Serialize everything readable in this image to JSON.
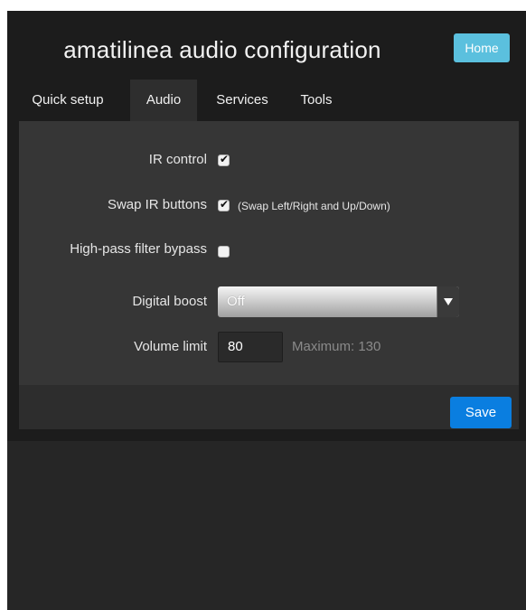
{
  "header": {
    "title": "amatilinea audio configuration",
    "home_label": "Home"
  },
  "tabs": [
    {
      "label": "Quick setup",
      "active": false
    },
    {
      "label": "Audio",
      "active": true
    },
    {
      "label": "Services",
      "active": false
    },
    {
      "label": "Tools",
      "active": false
    }
  ],
  "form": {
    "ir_control": {
      "label": "IR control",
      "checked": true
    },
    "swap_ir": {
      "label": "Swap IR buttons",
      "checked": true,
      "hint": "(Swap Left/Right and Up/Down)"
    },
    "hp_filter": {
      "label": "High-pass filter bypass",
      "checked": false
    },
    "digital_boost": {
      "label": "Digital boost",
      "value": "Off"
    },
    "volume_limit": {
      "label": "Volume limit",
      "value": "80",
      "max_text": "Maximum: 130"
    }
  },
  "footer": {
    "save_label": "Save"
  },
  "colors": {
    "home_button": "#5bc0de",
    "save_button": "#0a7ee0",
    "background": "#262626"
  }
}
